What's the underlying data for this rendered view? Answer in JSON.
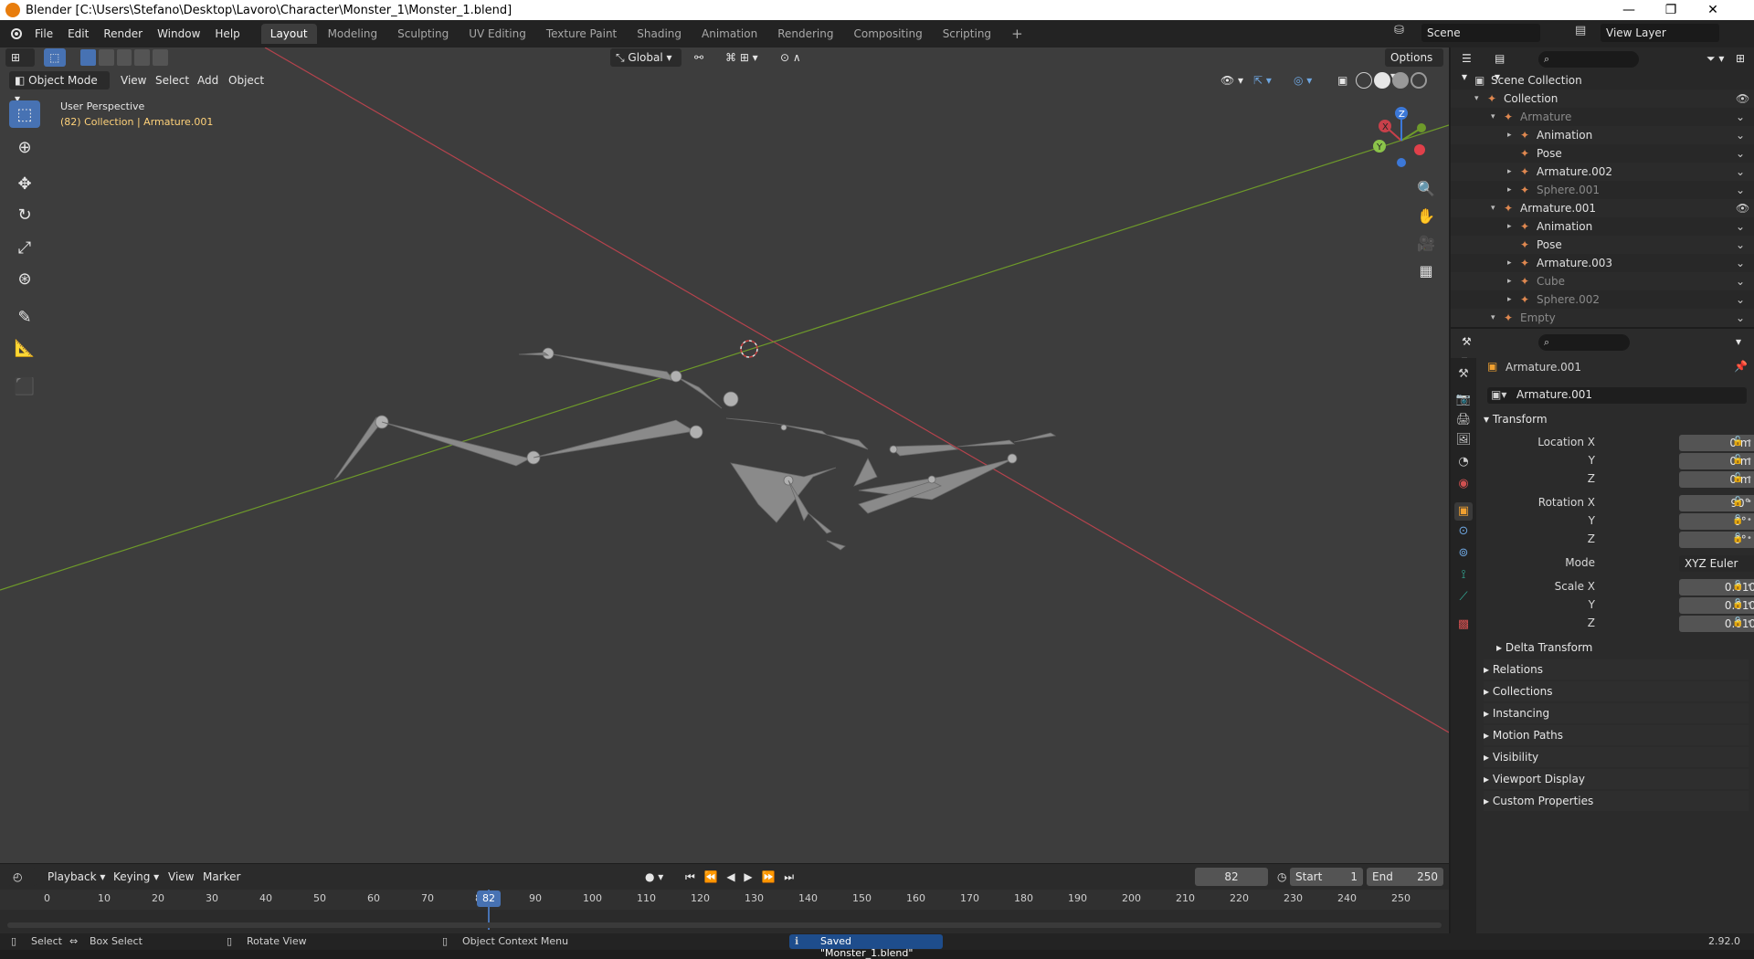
{
  "window": {
    "title": "Blender [C:\\Users\\Stefano\\Desktop\\Lavoro\\Character\\Monster_1\\Monster_1.blend]",
    "minimize": "—",
    "maximize": "❐",
    "close": "✕"
  },
  "menubar": {
    "items": [
      "File",
      "Edit",
      "Render",
      "Window",
      "Help"
    ],
    "workspaces": [
      "Layout",
      "Modeling",
      "Sculpting",
      "UV Editing",
      "Texture Paint",
      "Shading",
      "Animation",
      "Rendering",
      "Compositing",
      "Scripting"
    ],
    "add_workspace": "+",
    "scene": "Scene",
    "view_layer": "View Layer"
  },
  "viewport": {
    "mode": "Object Mode",
    "menus": [
      "View",
      "Select",
      "Add",
      "Object"
    ],
    "orientation": "Global",
    "options": "Options",
    "overlay_title": "User Perspective",
    "overlay_subtitle": "(82) Collection | Armature.001",
    "gizmo_x": "X",
    "gizmo_y": "Y",
    "gizmo_z": "Z"
  },
  "outliner": {
    "root": "Scene Collection",
    "rows": [
      {
        "label": "Collection",
        "indent": 1
      },
      {
        "label": "Armature",
        "indent": 2,
        "dim": true
      },
      {
        "label": "Animation",
        "indent": 3
      },
      {
        "label": "Pose",
        "indent": 3
      },
      {
        "label": "Armature.002",
        "indent": 3
      },
      {
        "label": "Sphere.001",
        "indent": 3,
        "dim": true
      },
      {
        "label": "Armature.001",
        "indent": 2
      },
      {
        "label": "Animation",
        "indent": 3
      },
      {
        "label": "Pose",
        "indent": 3
      },
      {
        "label": "Armature.003",
        "indent": 3
      },
      {
        "label": "Cube",
        "indent": 3,
        "dim": true
      },
      {
        "label": "Sphere.002",
        "indent": 3,
        "dim": true
      },
      {
        "label": "Empty",
        "indent": 2,
        "dim": true
      }
    ]
  },
  "properties": {
    "object_name": "Armature.001",
    "name_field": "Armature.001",
    "transform": {
      "header": "Transform",
      "location_label": "Location X",
      "rotation_label": "Rotation X",
      "y_label": "Y",
      "z_label": "Z",
      "location": [
        "0 m",
        "0 m",
        "0 m"
      ],
      "rotation": [
        "90°",
        "0°",
        "0°"
      ],
      "mode_label": "Mode",
      "mode_value": "XYZ Euler",
      "scale_label": "Scale X",
      "scale": [
        "0.010",
        "0.010",
        "0.010"
      ],
      "delta": "Delta Transform"
    },
    "panels": [
      "Relations",
      "Collections",
      "Instancing",
      "Motion Paths",
      "Visibility",
      "Viewport Display",
      "Custom Properties"
    ]
  },
  "timeline": {
    "menus": [
      "Playback",
      "Keying",
      "View",
      "Marker"
    ],
    "current_frame": "82",
    "start_label": "Start",
    "start": "1",
    "end_label": "End",
    "end": "250",
    "ticks": [
      "0",
      "10",
      "20",
      "30",
      "40",
      "50",
      "60",
      "70",
      "80",
      "90",
      "100",
      "110",
      "120",
      "130",
      "140",
      "150",
      "160",
      "170",
      "180",
      "190",
      "200",
      "210",
      "220",
      "230",
      "240",
      "250"
    ],
    "playhead_label": "82"
  },
  "statusbar": {
    "select": "Select",
    "box_select": "Box Select",
    "rotate_view": "Rotate View",
    "context_menu": "Object Context Menu",
    "message": "Saved \"Monster_1.blend\"",
    "version": "2.92.0"
  },
  "colors": {
    "accent": "#4772b3",
    "x_axis": "#c8404a",
    "y_axis": "#6e9a2a",
    "z_axis": "#3c78d8",
    "active_text": "#ffd27a"
  }
}
